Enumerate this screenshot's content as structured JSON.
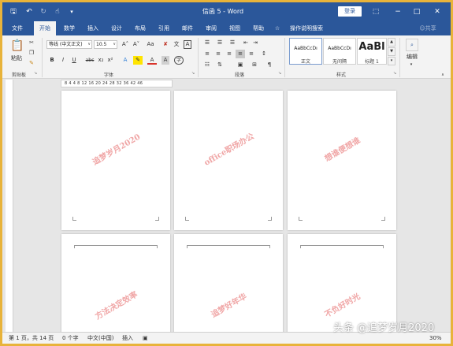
{
  "titlebar": {
    "doc_title": "信函 5  -  Word",
    "login_label": "登录",
    "qa_icons": [
      "save-icon",
      "undo-icon",
      "redo-icon",
      "touch-mode-icon",
      "customize-icon"
    ],
    "window_buttons": [
      "ribbon-display-icon",
      "minimize-icon",
      "restore-icon",
      "close-icon"
    ]
  },
  "tabs": [
    {
      "label": "文件",
      "active": false
    },
    {
      "label": "开始",
      "active": true
    },
    {
      "label": "数学",
      "active": false
    },
    {
      "label": "插入",
      "active": false
    },
    {
      "label": "设计",
      "active": false
    },
    {
      "label": "布局",
      "active": false
    },
    {
      "label": "引用",
      "active": false
    },
    {
      "label": "邮件",
      "active": false
    },
    {
      "label": "审阅",
      "active": false
    },
    {
      "label": "视图",
      "active": false
    },
    {
      "label": "帮助",
      "active": false
    }
  ],
  "tell_me": "操作说明搜索",
  "share_label": "共享",
  "ribbon": {
    "clipboard": {
      "paste_label": "粘贴",
      "group_label": "剪贴板"
    },
    "font": {
      "font_name": "等线 (中文正文)",
      "font_size": "10.5",
      "group_label": "字体",
      "row2": [
        "B",
        "I",
        "U",
        "abc",
        "x₂",
        "x²"
      ],
      "grow": "A˄",
      "shrink": "A˅",
      "change_case": "Aa",
      "phonetic": "文",
      "border_char": "A"
    },
    "paragraph": {
      "group_label": "段落"
    },
    "styles": {
      "group_label": "样式",
      "items": [
        {
          "preview": "AaBbCcDı",
          "name": "正文"
        },
        {
          "preview": "AaBbCcDı",
          "name": "无间隔"
        },
        {
          "preview": "AaBl",
          "name": "标题 1"
        }
      ]
    },
    "editing": {
      "label": "编辑"
    }
  },
  "ruler": {
    "text": "8  4      4   8  12  16  20  24  28  32  36     42  46"
  },
  "pages": [
    {
      "watermark": "追梦岁月2020"
    },
    {
      "watermark": "office职场办公"
    },
    {
      "watermark": "想谁便想谁"
    },
    {
      "watermark": "方法决定效率"
    },
    {
      "watermark": "追梦好年华"
    },
    {
      "watermark": "不负好时光"
    }
  ],
  "status": {
    "page": "第 1 页，共 14 页",
    "words": "0 个字",
    "language": "中文(中国)",
    "mode": "插入",
    "zoom": "30%"
  },
  "credit": "头条 @追梦岁月2020"
}
